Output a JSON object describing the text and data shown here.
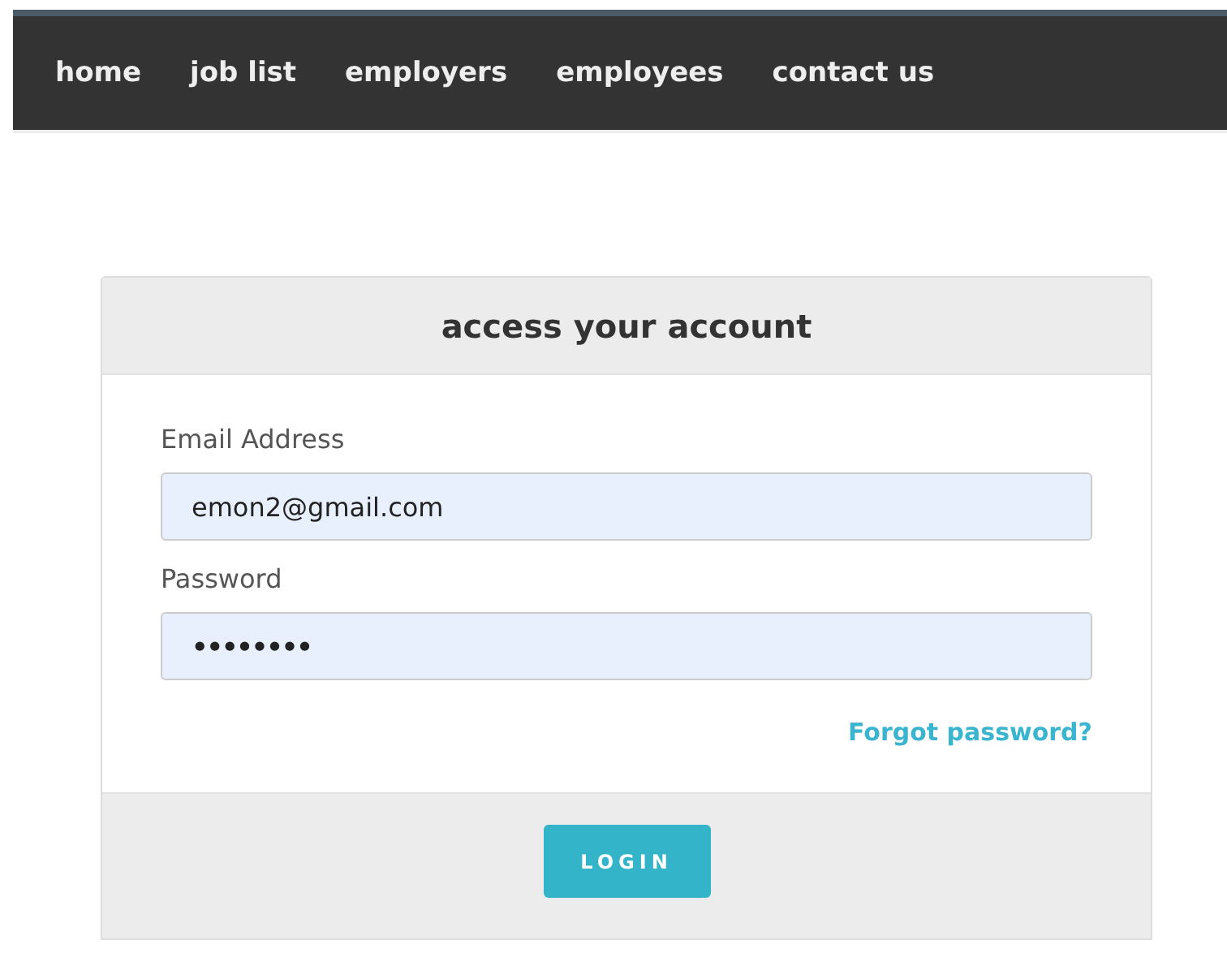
{
  "nav": {
    "items": [
      {
        "label": "home"
      },
      {
        "label": "job list"
      },
      {
        "label": "employers"
      },
      {
        "label": "employees"
      },
      {
        "label": "contact us"
      }
    ]
  },
  "login": {
    "title": "access your account",
    "fields": [
      {
        "label": "Email Address",
        "value": "emon2@gmail.com"
      },
      {
        "label": "Password",
        "value": "••••••••"
      }
    ],
    "forgot_link": "Forgot password?",
    "button": "LOGIN"
  }
}
